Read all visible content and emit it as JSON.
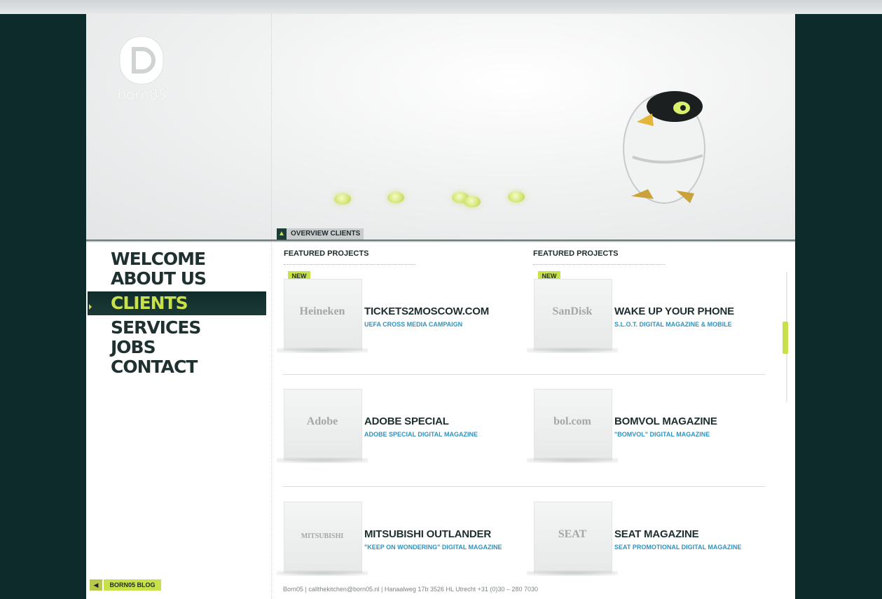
{
  "brand": {
    "logo_text": "born05",
    "accent_color": "#c8e04a",
    "dark_color": "#0d2b2b",
    "link_color": "#2f93c0"
  },
  "hero": {
    "overview_tab": "OVERVIEW CLIENTS",
    "overview_icon": "arrow-up-icon"
  },
  "nav": {
    "items": [
      {
        "label": "WELCOME"
      },
      {
        "label": "ABOUT US"
      },
      {
        "label": "CLIENTS"
      },
      {
        "label": "SERVICES"
      },
      {
        "label": "JOBS"
      },
      {
        "label": "CONTACT"
      }
    ],
    "active": "CLIENTS",
    "blog_label": "BORN05 BLOG",
    "blog_icon": "arrow-left-icon"
  },
  "main": {
    "heading_left": "FEATURED PROJECTS",
    "heading_right": "FEATURED PROJECTS",
    "new_label": "NEW",
    "projects": [
      {
        "logo": "Heineken",
        "title": "TICKETS2MOSCOW.COM",
        "subtitle": "UEFA CROSS MEDIA CAMPAIGN"
      },
      {
        "logo": "SanDisk",
        "title": "WAKE UP YOUR PHONE",
        "subtitle": "S.L.O.T. DIGITAL MAGAZINE & MOBILE"
      },
      {
        "logo": "Adobe",
        "title": "ADOBE SPECIAL",
        "subtitle": "ADOBE SPECIAL DIGITAL MAGAZINE"
      },
      {
        "logo": "bol.com",
        "title": "BOMVOL MAGAZINE",
        "subtitle": "\"BOMVOL\" DIGITAL MAGAZINE"
      },
      {
        "logo": "MITSUBISHI",
        "title": "MITSUBISHI OUTLANDER",
        "subtitle": "\"KEEP ON WONDERING\" DIGITAL MAGAZINE"
      },
      {
        "logo": "SEAT",
        "title": "SEAT MAGAZINE",
        "subtitle": "SEAT PROMOTIONAL DIGITAL MAGAZINE"
      }
    ]
  },
  "footer": {
    "text": "Born05 | callthekitchen@born05.nl | Hanaalweg 17b 3526 HL Utrecht +31 (0)30 – 280 7030"
  }
}
